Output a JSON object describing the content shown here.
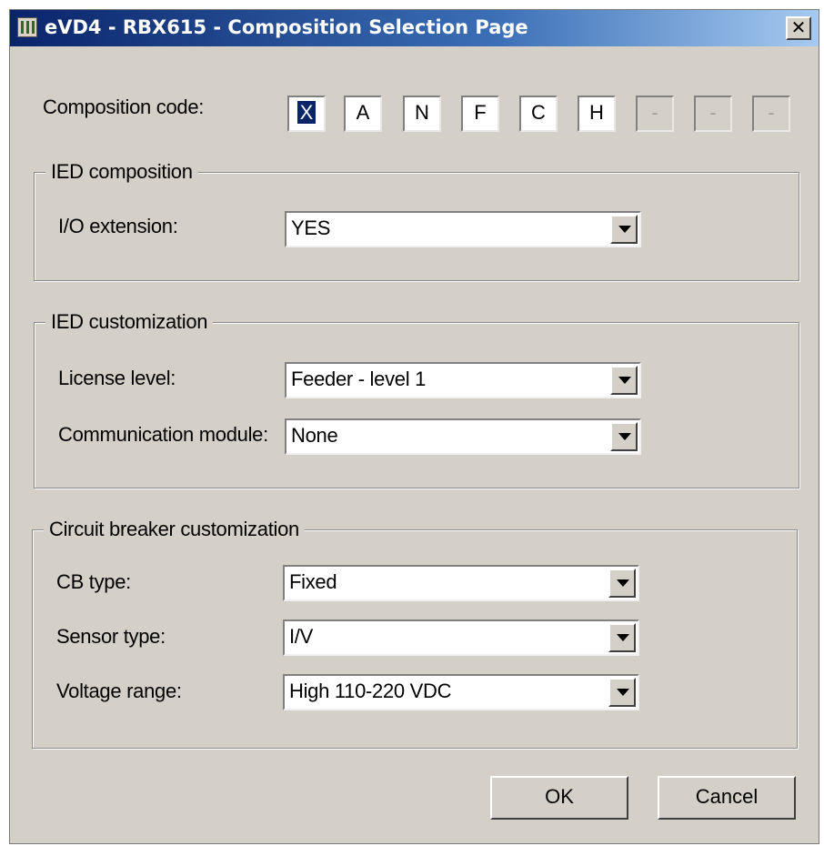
{
  "window": {
    "title": "eVD4 - RBX615 - Composition Selection Page",
    "close_glyph": "✕"
  },
  "composition": {
    "label": "Composition code:",
    "codes": [
      "X",
      "A",
      "N",
      "F",
      "C",
      "H",
      "-",
      "-",
      "-"
    ]
  },
  "ied_composition": {
    "legend": "IED composition",
    "io_extension": {
      "label": "I/O extension:",
      "value": "YES"
    }
  },
  "ied_customization": {
    "legend": "IED customization",
    "license_level": {
      "label": "License level:",
      "value": "Feeder - level 1"
    },
    "communication_module": {
      "label": "Communication module:",
      "value": "None"
    }
  },
  "cb_customization": {
    "legend": "Circuit breaker customization",
    "cb_type": {
      "label": "CB type:",
      "value": "Fixed"
    },
    "sensor_type": {
      "label": "Sensor type:",
      "value": "I/V"
    },
    "voltage_range": {
      "label": "Voltage range:",
      "value": "High 110-220 VDC"
    }
  },
  "buttons": {
    "ok": "OK",
    "cancel": "Cancel"
  }
}
